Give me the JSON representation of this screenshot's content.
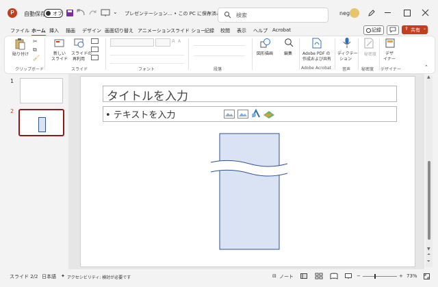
{
  "titlebar": {
    "autosave_label": "自動保存",
    "autosave_state": "オフ",
    "filename": "プレゼンテーション… • この PC に保存済み",
    "search_placeholder": "検索",
    "user": "neg"
  },
  "menu": [
    "ファイル",
    "ホーム",
    "挿入",
    "描画",
    "デザイン",
    "画面切り替え",
    "アニメーション",
    "スライド ショー",
    "記録",
    "校閲",
    "表示",
    "ヘルプ",
    "Acrobat"
  ],
  "menu_active": "ホーム",
  "buttons": {
    "record": "記録",
    "share": "共有"
  },
  "ribbon": {
    "paste": "貼り付け",
    "new_slide_1": "新しい",
    "new_slide_2": "スライド",
    "reuse_1": "スライドの",
    "reuse_2": "再利用",
    "shapes": "図形描画",
    "edit": "編集",
    "pdf_1": "Adobe PDF の",
    "pdf_2": "作成および共有",
    "dictate": "ディクテー",
    "dictate_2": "ション",
    "sensitivity": "秘密度",
    "designer_1": "デザ",
    "designer_2": "イナー"
  },
  "groups": [
    "クリップボード",
    "スライド",
    "フォント",
    "段落",
    "Adobe Acrobat",
    "音声",
    "秘密度",
    "デザイナー"
  ],
  "thumbnails": [
    {
      "num": "1"
    },
    {
      "num": "2"
    }
  ],
  "slide": {
    "title_placeholder": "タイトルを入力",
    "body_placeholder": "• テキストを入力",
    "shape_fill": "#dae3f3",
    "shape_stroke": "#2f528f"
  },
  "statusbar": {
    "slide_pos": "スライド 2/2",
    "language": "日本語",
    "accessibility": "アクセシビリティ: 検討が必要です",
    "notes": "ノート",
    "zoom": "73%"
  },
  "colors": {
    "accent": "#c43e1c",
    "thumb_selected": "#8b1a1a"
  }
}
